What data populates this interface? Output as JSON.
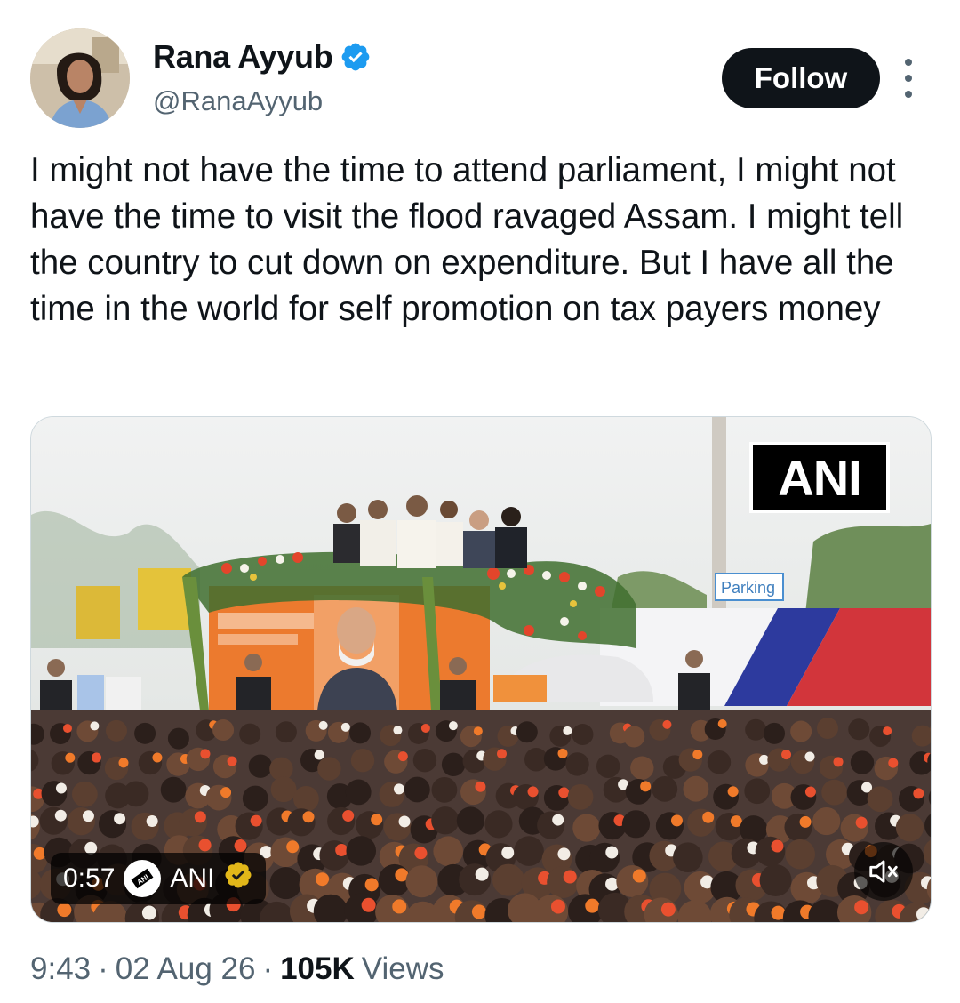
{
  "author": {
    "display_name": "Rana Ayyub",
    "handle": "@RanaAyyub",
    "verified": true,
    "avatar_icon": "profile-photo"
  },
  "actions": {
    "follow_label": "Follow",
    "more_icon": "more-vertical-icon"
  },
  "tweet": {
    "text": "I might not have the time to attend parliament, I might not have the time to visit the flood ravaged Assam. I might tell the country to cut down on expenditure. But I have all the time in the world for self promotion on tax payers money"
  },
  "media": {
    "type": "video",
    "watermark": "ANI",
    "duration": "0:57",
    "source_name": "ANI",
    "source_verified": true,
    "banner_sign": "Parking",
    "mute_icon": "speaker-muted-icon"
  },
  "meta": {
    "time": "9:43",
    "separator": "·",
    "date": "02 Aug 26",
    "views_count": "105K",
    "views_label": "Views"
  },
  "colors": {
    "verified_blue": "#1d9bf0",
    "verified_gold": "#e2b719",
    "text_primary": "#0f1419",
    "text_secondary": "#536471",
    "follow_button_bg": "#0f1419"
  }
}
